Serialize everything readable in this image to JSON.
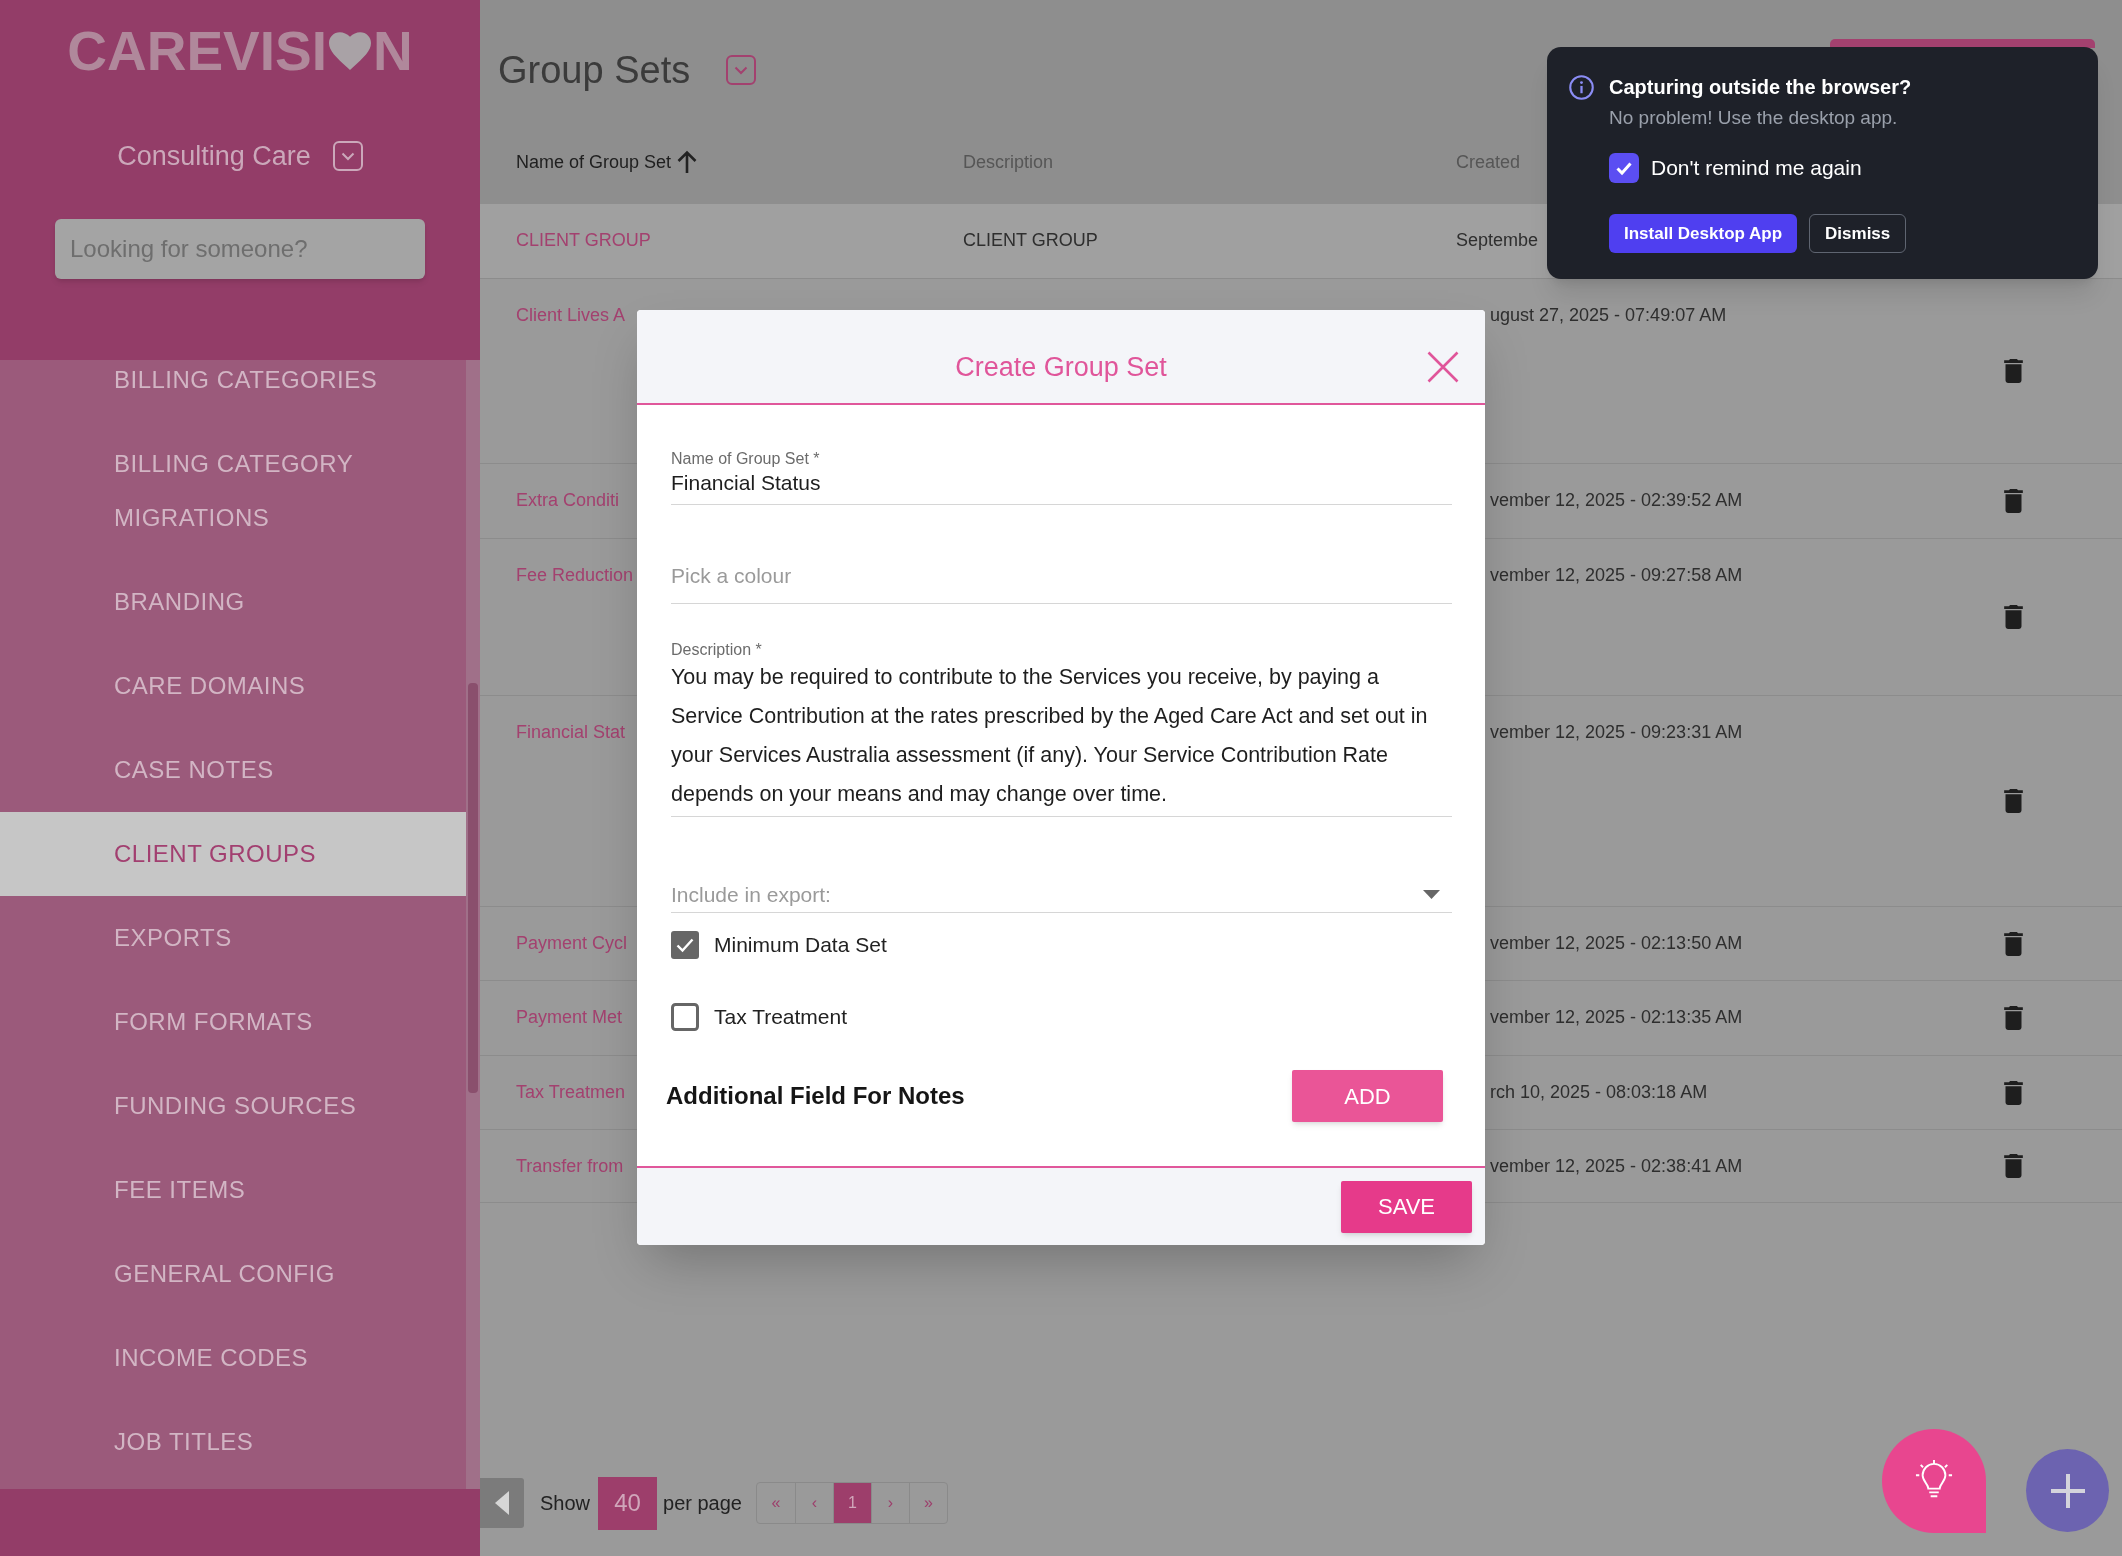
{
  "sidebar": {
    "logo": {
      "text_start": "CAREVISI",
      "text_end": "N"
    },
    "organization": "Consulting Care",
    "search": {
      "placeholder": "Looking for someone?"
    },
    "items": [
      {
        "label": "BILLING CATEGORIES",
        "selected": false
      },
      {
        "label": "BILLING CATEGORY MIGRATIONS",
        "selected": false
      },
      {
        "label": "BRANDING",
        "selected": false
      },
      {
        "label": "CARE DOMAINS",
        "selected": false
      },
      {
        "label": "CASE NOTES",
        "selected": false
      },
      {
        "label": "CLIENT GROUPS",
        "selected": true
      },
      {
        "label": "EXPORTS",
        "selected": false
      },
      {
        "label": "FORM FORMATS",
        "selected": false
      },
      {
        "label": "FUNDING SOURCES",
        "selected": false
      },
      {
        "label": "FEE ITEMS",
        "selected": false
      },
      {
        "label": "GENERAL CONFIG",
        "selected": false
      },
      {
        "label": "INCOME CODES",
        "selected": false
      },
      {
        "label": "JOB TITLES",
        "selected": false
      }
    ]
  },
  "page": {
    "title": "Group Sets"
  },
  "table": {
    "columns": [
      {
        "label": "Name of Group Set",
        "sorted": true
      },
      {
        "label": "Description",
        "sorted": false
      },
      {
        "label": "Created",
        "sorted": false
      }
    ],
    "rows": [
      {
        "name": "CLIENT GROUP",
        "description": "CLIENT GROUP",
        "created": "Septembe"
      },
      {
        "name": "Client Lives A",
        "created": "ugust 27, 2025 - 07:49:07 AM"
      },
      {
        "name": "Extra Conditi",
        "created": "vember 12, 2025 - 02:39:52 AM"
      },
      {
        "name": "Fee Reduction",
        "created": "vember 12, 2025 - 09:27:58 AM"
      },
      {
        "name": "Financial Stat",
        "created": "vember 12, 2025 - 09:23:31 AM"
      },
      {
        "name": "Payment Cycl",
        "created": "vember 12, 2025 - 02:13:50 AM"
      },
      {
        "name": "Payment Met",
        "created": "vember 12, 2025 - 02:13:35 AM"
      },
      {
        "name": "Tax Treatmen",
        "created": "rch 10, 2025 - 08:03:18 AM"
      },
      {
        "name": "Transfer from",
        "created": "vember 12, 2025 - 02:38:41 AM"
      }
    ]
  },
  "pagination": {
    "show_label": "Show",
    "page_size": "40",
    "per_page_label": "per page",
    "pages": [
      {
        "label": "«",
        "selected": false
      },
      {
        "label": "‹",
        "selected": false
      },
      {
        "label": "1",
        "selected": true
      },
      {
        "label": "›",
        "selected": false
      },
      {
        "label": "»",
        "selected": false
      }
    ]
  },
  "modal": {
    "title": "Create Group Set",
    "fields": [
      {
        "kind": "text",
        "label": "Name of Group Set *",
        "value": "Financial Status"
      },
      {
        "kind": "color",
        "placeholder": "Pick a colour"
      },
      {
        "kind": "textarea",
        "label": "Description *",
        "value": "You may be required to contribute to the Services you receive, by paying a Service Contribution at the rates prescribed by the Aged Care Act and set out in your Services Australia assessment (if any). Your Service Contribution Rate depends on your means and may change over time."
      },
      {
        "kind": "select",
        "placeholder": "Include in export:"
      }
    ],
    "export_options": [
      {
        "label": "Minimum Data Set",
        "checked": true
      },
      {
        "label": "Tax Treatment",
        "checked": false
      }
    ],
    "notes": {
      "label": "Additional Field For Notes",
      "button": "ADD"
    },
    "save_button": "SAVE"
  },
  "toast": {
    "title": "Capturing outside the browser?",
    "message": "No problem! Use the desktop app.",
    "checkbox": {
      "label": "Don't remind me again",
      "checked": true
    },
    "buttons": [
      {
        "label": "Install Desktop App",
        "kind": "primary"
      },
      {
        "label": "Dismiss",
        "kind": "secondary"
      }
    ]
  }
}
